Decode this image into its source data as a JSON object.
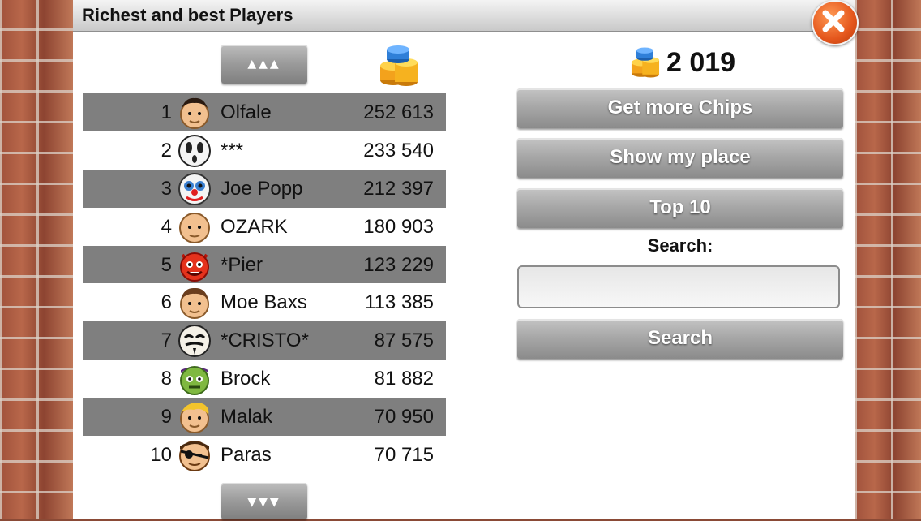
{
  "window": {
    "title": "Richest and best Players",
    "close_icon": "close-x-icon"
  },
  "leaderboard": {
    "scroll_up_label": "▲▲▲",
    "scroll_down_label": "▼▼▼",
    "coin_icon": "chips-stack-icon",
    "rows": [
      {
        "rank": "1",
        "name": "Olfale",
        "score": "252 613",
        "avatar": "man-short-hair-avatar"
      },
      {
        "rank": "2",
        "name": "***",
        "score": "233 540",
        "avatar": "ghost-mask-avatar"
      },
      {
        "rank": "3",
        "name": "Joe Popp",
        "score": "212 397",
        "avatar": "clown-mask-avatar"
      },
      {
        "rank": "4",
        "name": "OZARK",
        "score": "180 903",
        "avatar": "bald-man-avatar"
      },
      {
        "rank": "5",
        "name": "*Pier",
        "score": "123 229",
        "avatar": "devil-avatar"
      },
      {
        "rank": "6",
        "name": "Moe Baxs",
        "score": "113 385",
        "avatar": "man-brown-hair-avatar"
      },
      {
        "rank": "7",
        "name": "*CRISTO*",
        "score": "87 575",
        "avatar": "guy-fawkes-mask-avatar"
      },
      {
        "rank": "8",
        "name": "Brock",
        "score": "81 882",
        "avatar": "zombie-avatar"
      },
      {
        "rank": "9",
        "name": "Malak",
        "score": "70 950",
        "avatar": "blond-man-avatar"
      },
      {
        "rank": "10",
        "name": "Paras",
        "score": "70 715",
        "avatar": "pirate-eyepatch-avatar"
      }
    ]
  },
  "sidebar": {
    "balance": "2 019",
    "balance_icon": "chips-stack-icon",
    "get_more_chips_label": "Get more Chips",
    "show_my_place_label": "Show my place",
    "top10_label": "Top 10",
    "search_label": "Search:",
    "search_value": "",
    "search_button_label": "Search"
  },
  "colors": {
    "row_dark": "#7f7f7f",
    "button_gray": "#a8a8a8",
    "close_orange": "#e4561c",
    "chip_orange": "#f3a21c",
    "chip_blue": "#2f7fd8"
  }
}
